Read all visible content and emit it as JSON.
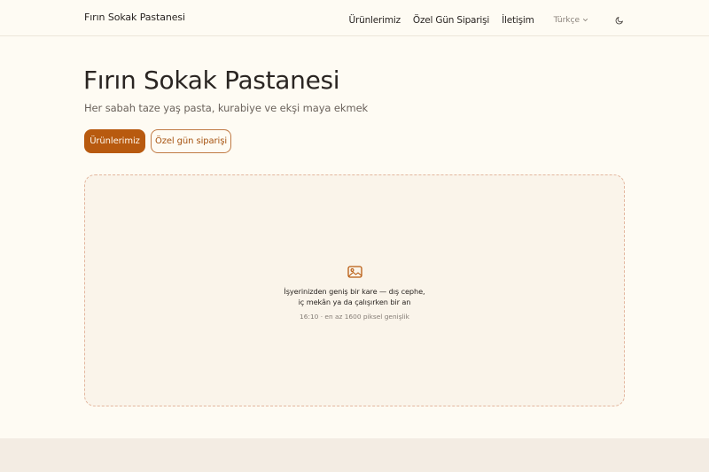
{
  "nav": {
    "brand": "Fırın Sokak Pastanesi",
    "links": [
      "Ürünlerimiz",
      "Özel Gün Siparişi",
      "İletişim"
    ],
    "language": "Türkçe"
  },
  "hero": {
    "title": "Fırın Sokak Pastanesi",
    "subtitle": "Her sabah taze yaş pasta, kurabiye ve ekşi maya ekmek",
    "primary_button": "Ürünlerimiz",
    "secondary_button": "Özel gün siparişi"
  },
  "image_placeholder": {
    "text": "İşyerinizden geniş bir kare — dış cephe, iç mekân ya da çalışırken bir an",
    "hint": "16:10 · en az 1600 piksel genişlik"
  },
  "colors": {
    "accent": "#b85a0f",
    "background": "#fefbf3"
  }
}
